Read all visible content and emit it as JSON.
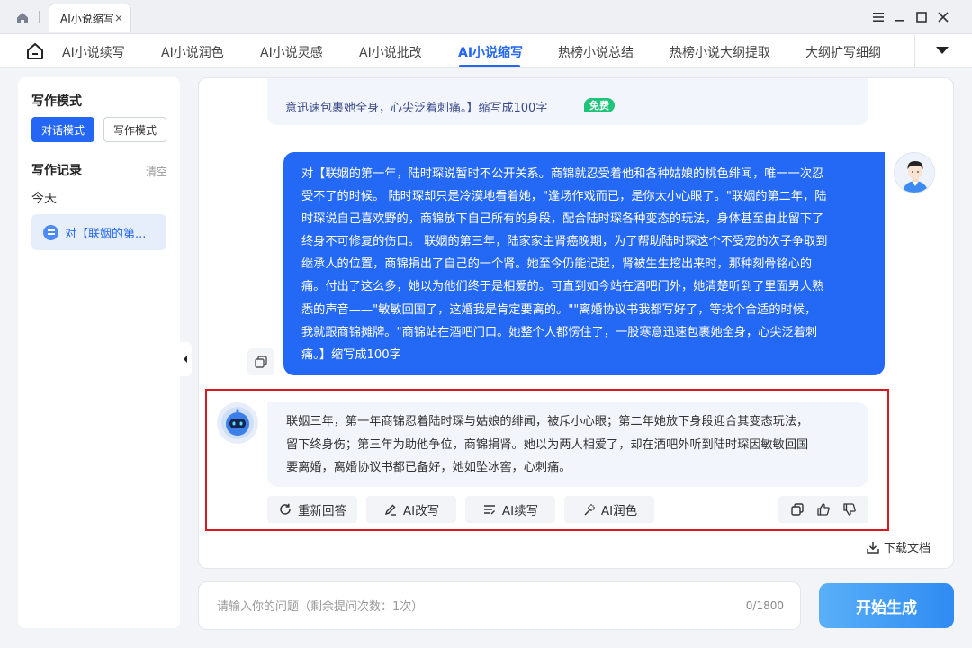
{
  "window": {
    "tab_title": "AI小说缩写",
    "tab_close": "×"
  },
  "nav": {
    "items": [
      {
        "label": "AI小说续写"
      },
      {
        "label": "AI小说润色"
      },
      {
        "label": "AI小说灵感"
      },
      {
        "label": "AI小说批改"
      },
      {
        "label": "AI小说缩写",
        "active": true
      },
      {
        "label": "热榜小说总结"
      },
      {
        "label": "热榜小说大纲提取"
      },
      {
        "label": "大纲扩写细纲"
      }
    ]
  },
  "sidebar": {
    "mode_heading": "写作模式",
    "mode_buttons": [
      "对话模式",
      "写作模式"
    ],
    "records_heading": "写作记录",
    "clear_label": "清空",
    "today_label": "今天",
    "record_item": "对【联姻的第..."
  },
  "chat": {
    "prev_message_tail": "意迅速包裹她全身，心尖泛着刺痛。】缩写成100字",
    "free_badge": "免费",
    "user_message_lines": [
      "对【联姻的第一年，陆时琛说暂时不公开关系。商锦就忍受着他和各种姑娘的桃色绯闻，唯一一次忍",
      "受不了的时候。 陆时琛却只是冷漠地看着她，\"逢场作戏而已，是你太小心眼了。\"联姻的第二年，陆",
      "时琛说自己喜欢野的，商锦放下自己所有的身段，配合陆时琛各种变态的玩法，身体甚至由此留下了",
      "终身不可修复的伤口。 联姻的第三年，陆家家主肾癌晚期，为了帮助陆时琛这个不受宠的次子争取到",
      "继承人的位置，商锦捐出了自己的一个肾。她至今仍能记起，肾被生生挖出来时，那种刻骨铭心的",
      "痛。付出了这么多，她以为他们终于是相爱的。可直到如今站在酒吧门外，她清楚听到了里面男人熟",
      "悉的声音——\"敏敏回国了，这婚我是肯定要离的。\"\"离婚协议书我都写好了，等找个合适的时候，",
      "我就跟商锦摊牌。\"商锦站在酒吧门口。她整个人都愣住了，一股寒意迅速包裹她全身，心尖泛着刺",
      "痛。】缩写成100字"
    ],
    "bot_message_lines": [
      "联姻三年，第一年商锦忍着陆时琛与姑娘的绯闻，被斥小心眼；第二年她放下身段迎合其变态玩法，",
      "留下终身伤；第三年为助他争位，商锦捐肾。她以为两人相爱了，却在酒吧外听到陆时琛因敏敏回国",
      "要离婚，离婚协议书都已备好，她如坠冰窖，心刺痛。"
    ],
    "actions": {
      "regenerate": "重新回答",
      "rewrite": "AI改写",
      "continue": "AI续写",
      "polish": "AI润色"
    },
    "download_label": "下载文档"
  },
  "input": {
    "placeholder": "请输入你的问题（剩余提问次数：1次）",
    "value": "",
    "char_count": "0/1800",
    "submit_label": "开始生成"
  },
  "colors": {
    "accent": "#2467f5",
    "user_bubble": "#2468f6",
    "free_badge": "#1ec47a",
    "highlight_box": "#d7191f"
  }
}
